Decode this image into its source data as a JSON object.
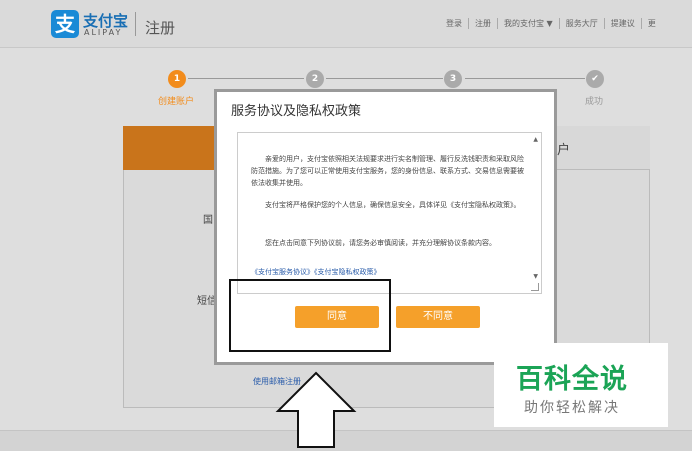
{
  "header": {
    "logo_glyph": "支",
    "logo_cn": "支付宝",
    "logo_en": "ALIPAY",
    "page_title": "注册",
    "nav": [
      "登录",
      "注册",
      "我的支付宝 ▼",
      "服务大厅",
      "提建议",
      "更"
    ]
  },
  "steps": [
    {
      "number": "1",
      "label": "创建账户",
      "active": true
    },
    {
      "number": "2",
      "label": "",
      "active": false
    },
    {
      "number": "3",
      "label": "",
      "active": false
    },
    {
      "number": "✔",
      "label": "成功",
      "active": false
    }
  ],
  "background": {
    "tab_right": "户",
    "label_country": "国",
    "label_sms": "短信",
    "email_register_link": "使用邮箱注册"
  },
  "dialog": {
    "title": "服务协议及隐私权政策",
    "paragraphs": [
      "亲爱的用户，支付宝依照相关法规要求进行实名制管理、履行反洗钱职责和采取风险防范措施。为了您可以正常使用支付宝服务，您的身份信息、联系方式、交易信息需要被依法收集并使用。",
      "支付宝将严格保护您的个人信息，确保信息安全，具体详见《支付宝隐私权政策》。",
      "您在点击同意下列协议前，请您务必审慎阅读，并充分理解协议条款内容。"
    ],
    "links": "《支付宝服务协议》《支付宝隐私权政策》",
    "agree_label": "同意",
    "disagree_label": "不同意"
  },
  "watermark": {
    "main": "百科全说",
    "sub": "助你轻松解决"
  },
  "colors": {
    "accent_orange": "#f5a02a",
    "step_active": "#f28c1c",
    "brand_blue": "#1a8ad6",
    "watermark_green": "#1ba456"
  }
}
